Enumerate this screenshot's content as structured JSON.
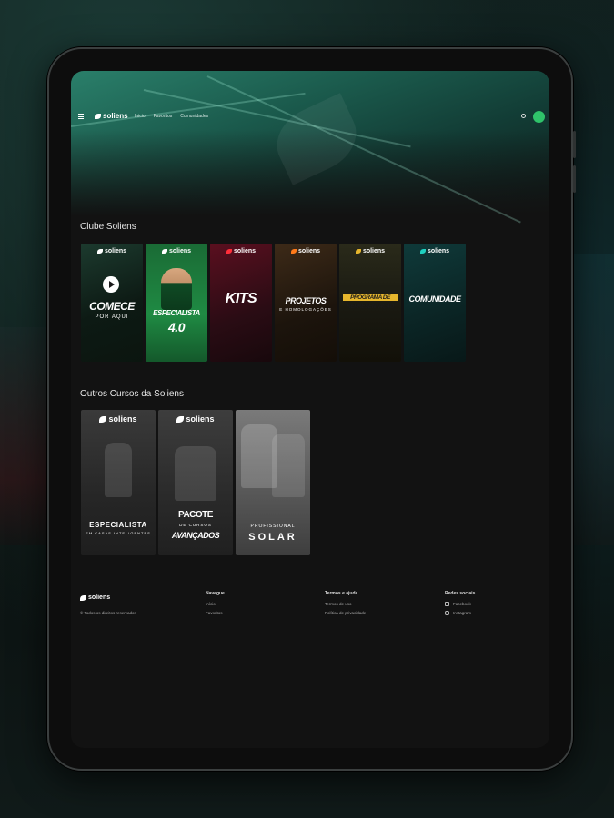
{
  "nav": {
    "logo": "soliens",
    "links": [
      "Inicio",
      "Favoritos",
      "Comunidades"
    ]
  },
  "sections": {
    "club_title": "Clube Soliens",
    "others_title": "Outros Cursos da Soliens"
  },
  "club_cards": [
    {
      "brand": "soliens",
      "big": "COMECE",
      "small": "POR AQUI"
    },
    {
      "brand": "soliens",
      "big": "ESPECIALISTA",
      "small": "4.0"
    },
    {
      "brand": "soliens",
      "big": "KITS",
      "small": ""
    },
    {
      "brand": "soliens",
      "big": "PROJETOS",
      "small": "E HOMOLOGAÇÕES"
    },
    {
      "brand": "soliens",
      "big": "PROGRAMA DE REPRESENTAÇÃO",
      "small": ""
    },
    {
      "brand": "soliens",
      "big": "COMUNIDADE",
      "small": ""
    }
  ],
  "other_cards": [
    {
      "brand": "soliens",
      "big": "ESPECIALISTA",
      "small": "EM CASAS INTELIGENTES"
    },
    {
      "brand": "soliens",
      "big": "PACOTE",
      "small": "DE CURSOS",
      "big2": "AVANÇADOS"
    },
    {
      "brand": "",
      "small": "PROFISSIONAL",
      "big": "SOLAR"
    }
  ],
  "footer": {
    "logo": "soliens",
    "copyright": "© Todos os direitos reservados",
    "columns": [
      {
        "head": "Navegue",
        "items": [
          "Início",
          "Favoritos"
        ]
      },
      {
        "head": "Termos e ajuda",
        "items": [
          "Termos de uso",
          "Política de privacidade"
        ]
      },
      {
        "head": "Redes sociais",
        "items": [
          "Facebook",
          "Instagram"
        ]
      }
    ]
  }
}
